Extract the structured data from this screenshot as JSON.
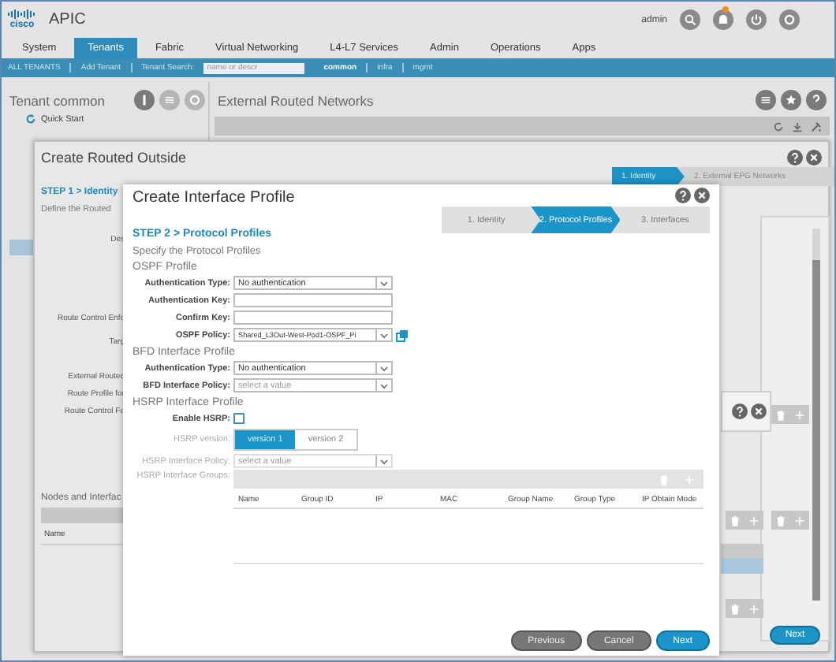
{
  "header": {
    "brand": "cisco",
    "app_title": "APIC",
    "user": "admin"
  },
  "nav_tabs": [
    {
      "label": "System",
      "selected": false
    },
    {
      "label": "Tenants",
      "selected": true
    },
    {
      "label": "Fabric",
      "selected": false
    },
    {
      "label": "Virtual Networking",
      "selected": false
    },
    {
      "label": "L4-L7 Services",
      "selected": false
    },
    {
      "label": "Admin",
      "selected": false
    },
    {
      "label": "Operations",
      "selected": false
    },
    {
      "label": "Apps",
      "selected": false
    }
  ],
  "sub_nav": {
    "links": [
      {
        "label": "ALL TENANTS",
        "selected": false
      },
      {
        "label": "Add Tenant",
        "selected": false
      }
    ],
    "search": {
      "label": "Tenant Search:",
      "placeholder": "name or descr"
    },
    "tenants": [
      {
        "label": "common",
        "selected": true
      },
      {
        "label": "infra",
        "selected": false
      },
      {
        "label": "mgmt",
        "selected": false
      }
    ]
  },
  "tenant_panel": {
    "title": "Tenant common",
    "quick_start": "Quick Start"
  },
  "main_panel": {
    "title": "External Routed Networks"
  },
  "routed_outside_dialog": {
    "title": "Create Routed Outside",
    "steps": [
      {
        "label": "1. Identity",
        "selected": true
      },
      {
        "label": "2. External EPG Networks",
        "selected": false
      }
    ],
    "step_heading": "STEP 1 > Identity",
    "description": "Define the Routed",
    "labels": [
      "Des",
      "Route Control Enfo",
      "Targ",
      "External Routed",
      "Route Profile for",
      "Route Control Fo"
    ],
    "section_title": "Nodes and Interfac",
    "table_columns": [
      "Name"
    ],
    "next_button": "Next"
  },
  "interface_profile_dialog": {
    "title": "Create Interface Profile",
    "steps": [
      {
        "label": "1. Identity",
        "selected": false
      },
      {
        "label": "2. Protocol Profiles",
        "selected": true
      },
      {
        "label": "3. Interfaces",
        "selected": false
      }
    ],
    "step_heading": "STEP 2 > Protocol Profiles",
    "description": "Specify the Protocol Profiles",
    "sections": [
      {
        "title": "OSPF Profile",
        "fields": [
          {
            "kind": "select",
            "label": "Authentication Type:",
            "value": "No authentication",
            "disabled": false
          },
          {
            "kind": "text",
            "label": "Authentication Key:",
            "disabled": false
          },
          {
            "kind": "text",
            "label": "Confirm Key:",
            "disabled": false
          },
          {
            "kind": "select",
            "label": "OSPF Policy:",
            "value": "Shared_L3Out-West-Pod1-OSPF_Pi",
            "disabled": false,
            "link_icon": true
          }
        ]
      },
      {
        "title": "BFD Interface Profile",
        "fields": [
          {
            "kind": "select",
            "label": "Authentication Type:",
            "value": "No authentication",
            "disabled": false
          },
          {
            "kind": "select",
            "label": "BFD Interface Policy:",
            "placeholder": "select a value",
            "disabled": false
          }
        ]
      },
      {
        "title": "HSRP Interface Profile",
        "fields": [
          {
            "kind": "checkbox",
            "label": "Enable HSRP:",
            "checked": false,
            "disabled": false
          },
          {
            "kind": "segmented",
            "label": "HSRP version:",
            "disabled": true,
            "options": [
              {
                "label": "version 1",
                "selected": true
              },
              {
                "label": "version 2",
                "selected": false
              }
            ]
          },
          {
            "kind": "select",
            "label": "HSRP Interface Policy:",
            "placeholder": "select a value",
            "disabled": true
          },
          {
            "kind": "table",
            "label": "HSRP Interface Groups:",
            "disabled": true,
            "columns": [
              "Name",
              "Group ID",
              "IP",
              "MAC",
              "Group Name",
              "Group Type",
              "IP Obtain Mode"
            ]
          }
        ]
      }
    ],
    "buttons": [
      {
        "kind": "secondary",
        "label": "Previous"
      },
      {
        "kind": "secondary",
        "label": "Cancel"
      },
      {
        "kind": "primary",
        "label": "Next"
      }
    ]
  }
}
